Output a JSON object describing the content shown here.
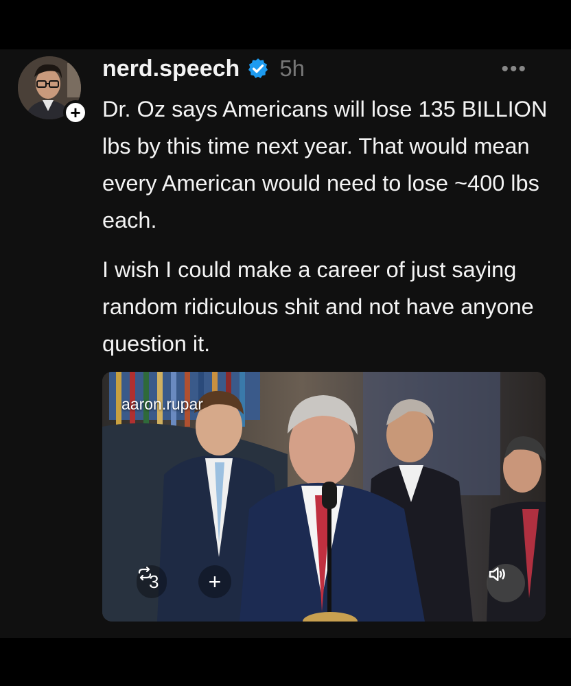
{
  "post": {
    "username": "nerd.speech",
    "timestamp": "5h",
    "more_label": "•••",
    "follow_label": "+",
    "paragraphs": [
      "Dr. Oz says Americans will lose 135 BILLION lbs by this time next year. That would mean every American would need to lose ~400 lbs each.",
      "I wish I could make a career of just saying random ridiculous shit and not have anyone question it."
    ],
    "media": {
      "watermark": "aaron.rupar",
      "repost_count": "3",
      "add_label": "+"
    }
  },
  "colors": {
    "background": "#101010",
    "verified_badge": "#1d9bf0",
    "muted_text": "#777777"
  },
  "icons": [
    "verified-icon",
    "more-icon",
    "plus-icon",
    "repost-icon",
    "volume-icon"
  ]
}
